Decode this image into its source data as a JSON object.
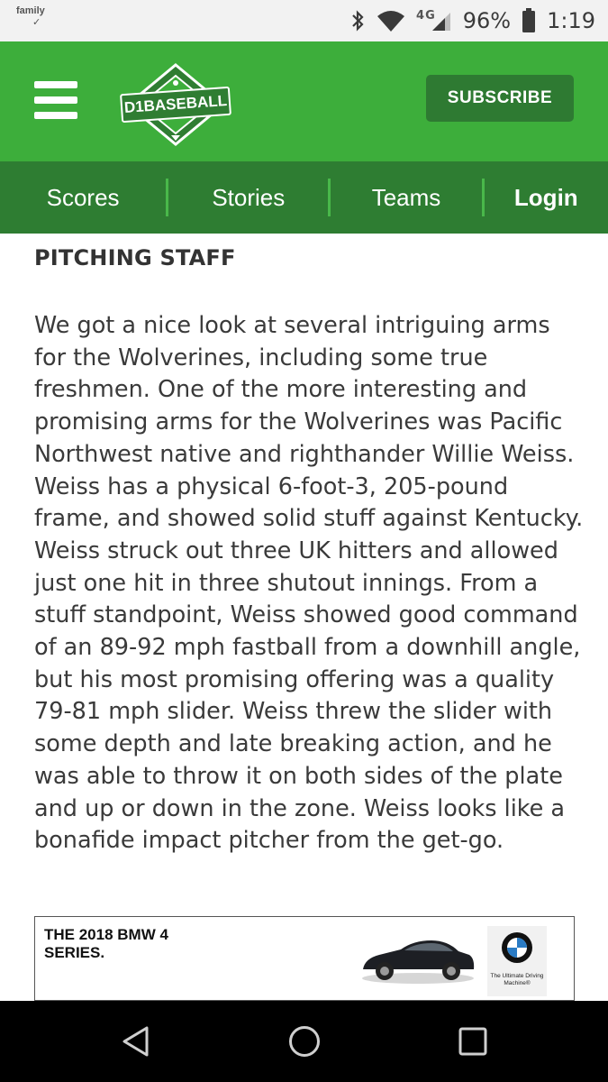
{
  "status_bar": {
    "notification_label": "family",
    "notification_check": "✓",
    "network_type": "4G",
    "battery": "96%",
    "time": "1:19",
    "icons": [
      "bluetooth-icon",
      "wifi-icon",
      "signal-icon",
      "battery-icon"
    ]
  },
  "header": {
    "logo_text": "D1BASEBALL",
    "subscribe_label": "SUBSCRIBE",
    "colors": {
      "header_bg": "#3dae3b",
      "nav_bg": "#2e7d32",
      "button_bg": "#2e7a32"
    }
  },
  "nav": {
    "items": [
      {
        "label": "Scores"
      },
      {
        "label": "Stories"
      },
      {
        "label": "Teams"
      },
      {
        "label": "Login"
      }
    ]
  },
  "article": {
    "section_title": "PITCHING STAFF",
    "paragraph": "We got a nice look at several intriguing arms for the Wolverines, including some true freshmen. One of the more interesting and promising arms for the Wolverines was Pacific Northwest native and righthander Willie Weiss. Weiss has a physical 6-foot-3, 205-pound frame, and showed solid stuff against Kentucky. Weiss struck out three UK hitters and allowed just one hit in three shutout innings. From a stuff standpoint, Weiss showed good command of an 89-92 mph fastball from a downhill angle, but his most promising offering was a quality 79-81 mph slider. Weiss threw the slider with some depth and late breaking action, and he was able to throw it on both sides of the plate and up or down in the zone. Weiss looks like a bonafide impact pitcher from the get-go."
  },
  "ad": {
    "headline": "THE 2018 BMW 4 SERIES.",
    "tagline": "The Ultimate Driving Machine®"
  },
  "system_nav": {
    "icons": [
      "back-icon",
      "home-icon",
      "recents-icon"
    ]
  }
}
